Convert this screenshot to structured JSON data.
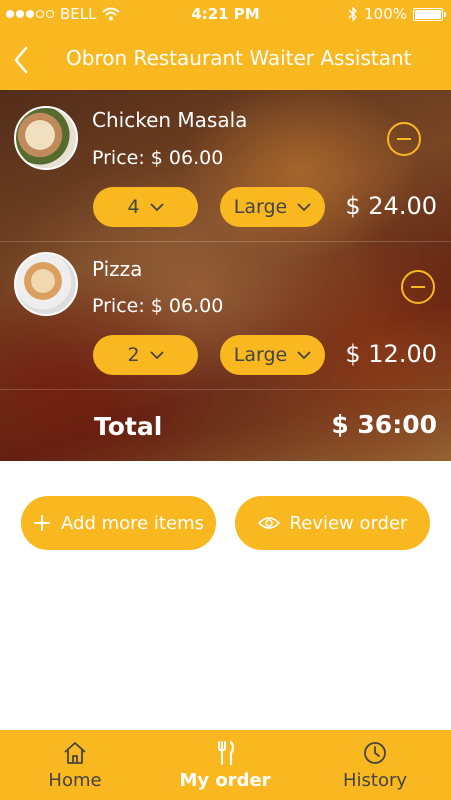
{
  "status_bar": {
    "carrier": "BELL",
    "time": "4:21 PM",
    "battery": "100%"
  },
  "header": {
    "title": "Obron Restaurant Waiter Assistant"
  },
  "orders": [
    {
      "name": "Chicken Masala",
      "price": "Price: $ 06.00",
      "quantity": "4",
      "size": "Large",
      "amount": "$ 24.00"
    },
    {
      "name": "Pizza",
      "price": "Price: $ 06.00",
      "quantity": "2",
      "size": "Large",
      "amount": "$ 12.00"
    }
  ],
  "total": {
    "label": "Total",
    "value": "$ 36:00"
  },
  "actions": {
    "add_more": "Add more items",
    "review": "Review order"
  },
  "tabbar": {
    "home": "Home",
    "my_order": "My order",
    "history": "History"
  },
  "colors": {
    "accent": "#F9B81F"
  }
}
